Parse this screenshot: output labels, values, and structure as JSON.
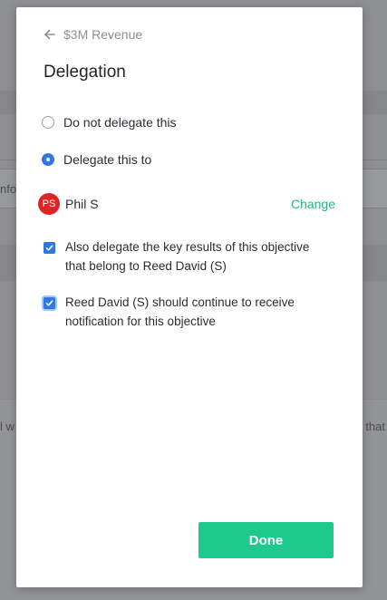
{
  "background": {
    "snippet_left_1": "nfo",
    "snippet_left_2": "l w",
    "snippet_right_2": "that"
  },
  "modal": {
    "back_label": "$3M Revenue",
    "title": "Delegation",
    "options": [
      {
        "label": "Do not delegate this",
        "selected": false
      },
      {
        "label": "Delegate this to",
        "selected": true
      }
    ],
    "assignee": {
      "initials": "PS",
      "name": "Phil S",
      "avatar_color": "#e02424",
      "change_label": "Change"
    },
    "checkboxes": [
      {
        "label": "Also delegate the key results of this objective that belong to Reed David (S)",
        "checked": true
      },
      {
        "label": "Reed David (S) should continue to receive notification for this objective",
        "checked": true
      }
    ],
    "done_label": "Done"
  },
  "colors": {
    "accent_blue": "#2f78e4",
    "accent_green": "#1dc98b",
    "link_green": "#1fb884",
    "overlay": "#8e8f92"
  },
  "icons": {
    "back": "arrow-left-icon",
    "check": "checkmark-icon"
  }
}
